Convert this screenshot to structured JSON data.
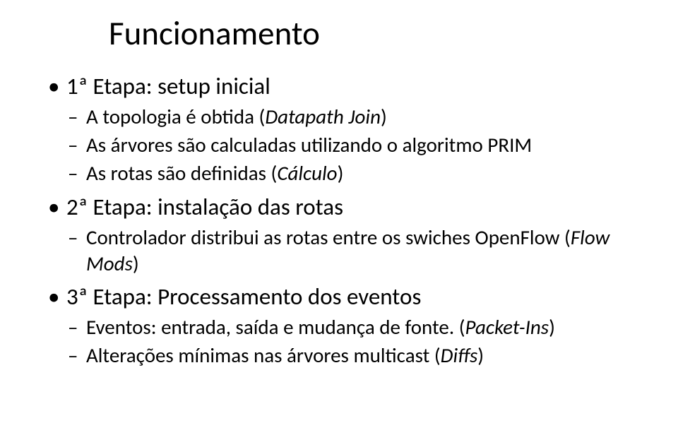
{
  "title": "Funcionamento",
  "sections": [
    {
      "heading_prefix": "1ª Etapa: setup inicial",
      "items": [
        {
          "pre": "A topologia é obtida (",
          "italic": "Datapath Join",
          "post": ")"
        },
        {
          "pre": "As árvores são calculadas utilizando o algoritmo PRIM",
          "italic": "",
          "post": ""
        },
        {
          "pre": "As rotas são definidas (",
          "italic": "Cálculo",
          "post": ")"
        }
      ]
    },
    {
      "heading_prefix": "2ª Etapa: instalação das rotas",
      "items": [
        {
          "pre": "Controlador distribui as rotas entre os swiches OpenFlow (",
          "italic": "Flow Mods",
          "post": ")"
        }
      ]
    },
    {
      "heading_prefix": "3ª Etapa: Processamento dos eventos",
      "items": [
        {
          "pre": "Eventos: entrada, saída e mudança de fonte. (",
          "italic": "Packet-Ins",
          "post": ")"
        },
        {
          "pre": "Alterações mínimas nas árvores multicast (",
          "italic": "Diffs",
          "post": ")"
        }
      ]
    }
  ]
}
